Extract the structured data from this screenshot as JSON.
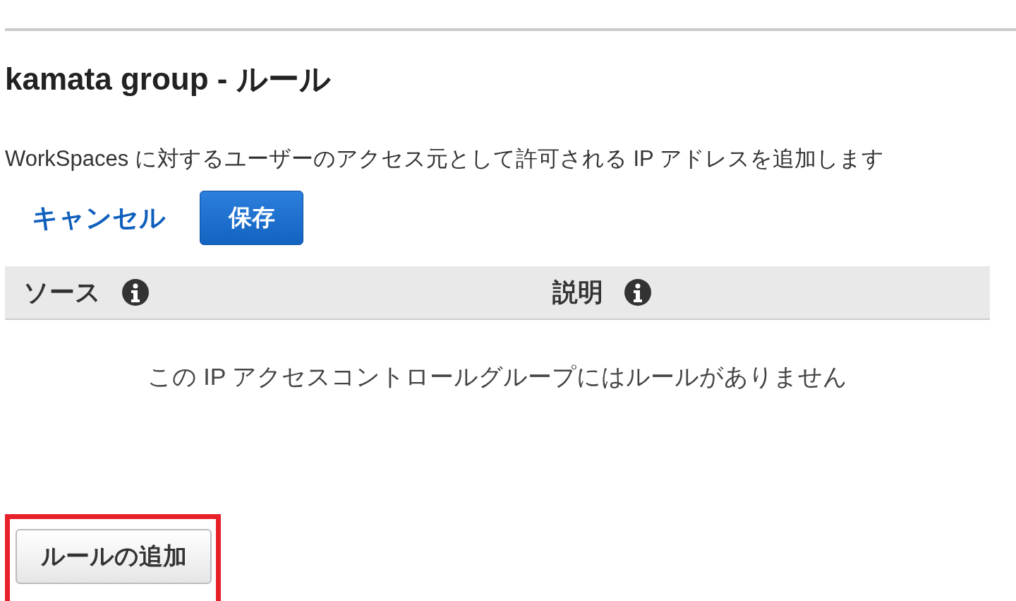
{
  "page_title": "kamata group - ルール",
  "description": "WorkSpaces に対するユーザーのアクセス元として許可される IP アドレスを追加します",
  "actions": {
    "cancel": "キャンセル",
    "save": "保存"
  },
  "table": {
    "columns": [
      {
        "label": "ソース",
        "info": true
      },
      {
        "label": "説明",
        "info": true
      }
    ],
    "empty_message": "この IP アクセスコントロールグループにはルールがありません"
  },
  "add_rule": {
    "label": "ルールの追加",
    "highlighted": true
  }
}
